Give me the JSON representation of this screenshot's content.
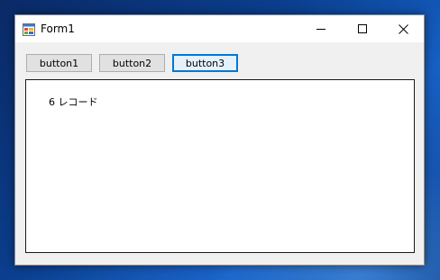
{
  "window": {
    "title": "Form1"
  },
  "titlebar": {
    "app_icon": "form-app-icon",
    "minimize_icon": "minimize-icon",
    "maximize_icon": "maximize-icon",
    "close_icon": "close-icon"
  },
  "toolbar": {
    "button1_label": "button1",
    "button2_label": "button2",
    "button3_label": "button3"
  },
  "output": {
    "text": "6 レコード"
  },
  "colors": {
    "focus_accent": "#0078d7",
    "button_face": "#e1e1e1",
    "window_bg": "#f0f0f0"
  }
}
